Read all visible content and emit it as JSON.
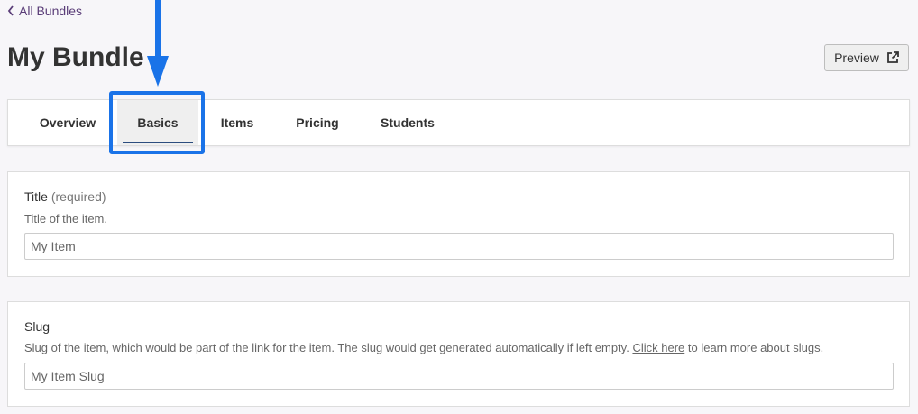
{
  "nav": {
    "back_label": "All Bundles",
    "back_icon": "chevron-left-icon"
  },
  "header": {
    "title": "My Bundle",
    "preview_label": "Preview",
    "preview_icon": "external-link-icon"
  },
  "tabs": [
    {
      "label": "Overview",
      "active": false
    },
    {
      "label": "Basics",
      "active": true
    },
    {
      "label": "Items",
      "active": false
    },
    {
      "label": "Pricing",
      "active": false
    },
    {
      "label": "Students",
      "active": false
    }
  ],
  "annotation": {
    "highlight_color": "#1a73e8",
    "target_tab": "Basics"
  },
  "form": {
    "title_field": {
      "label": "Title",
      "required_note": "(required)",
      "description": "Title of the item.",
      "value": "",
      "placeholder": "My Item"
    },
    "slug_field": {
      "label": "Slug",
      "description_before": "Slug of the item, which would be part of the link for the item. The slug would get generated automatically if left empty.",
      "link_text": "Click here",
      "description_after": "to learn more about slugs.",
      "value": "",
      "placeholder": "My Item Slug"
    }
  },
  "colors": {
    "link": "#5a3d78",
    "background": "#f7f6f9",
    "tab_underline": "#2b4c7e"
  }
}
